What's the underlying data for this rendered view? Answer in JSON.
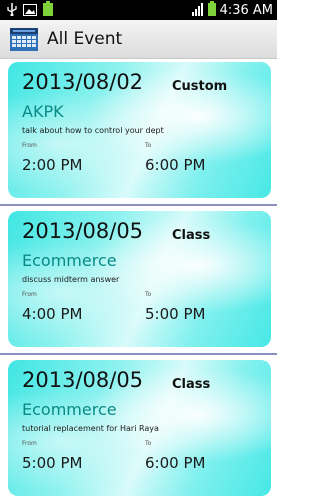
{
  "status_bar": {
    "time": "4:36 AM",
    "icons": [
      "usb-icon",
      "image-icon",
      "battery-icon",
      "signal-icon",
      "battery-icon"
    ]
  },
  "action_bar": {
    "title": "All Event",
    "icon": "calendar-icon"
  },
  "colors": {
    "accent": "#0a8a86",
    "card_cyan": "#46e8e6",
    "separator": "#8a8fbf"
  },
  "events": [
    {
      "date": "2013/08/02",
      "type": "Custom",
      "title": "AKPK",
      "description": "talk about how to control your dept",
      "from_label": "From",
      "to_label": "To",
      "from_time": "2:00 PM",
      "to_time": "6:00 PM"
    },
    {
      "date": "2013/08/05",
      "type": "Class",
      "title": "Ecommerce",
      "description": "discuss midterm answer",
      "from_label": "From",
      "to_label": "To",
      "from_time": "4:00 PM",
      "to_time": "5:00 PM"
    },
    {
      "date": "2013/08/05",
      "type": "Class",
      "title": "Ecommerce",
      "description": "tutorial replacement for Hari Raya",
      "from_label": "From",
      "to_label": "To",
      "from_time": "5:00 PM",
      "to_time": "6:00 PM"
    }
  ]
}
